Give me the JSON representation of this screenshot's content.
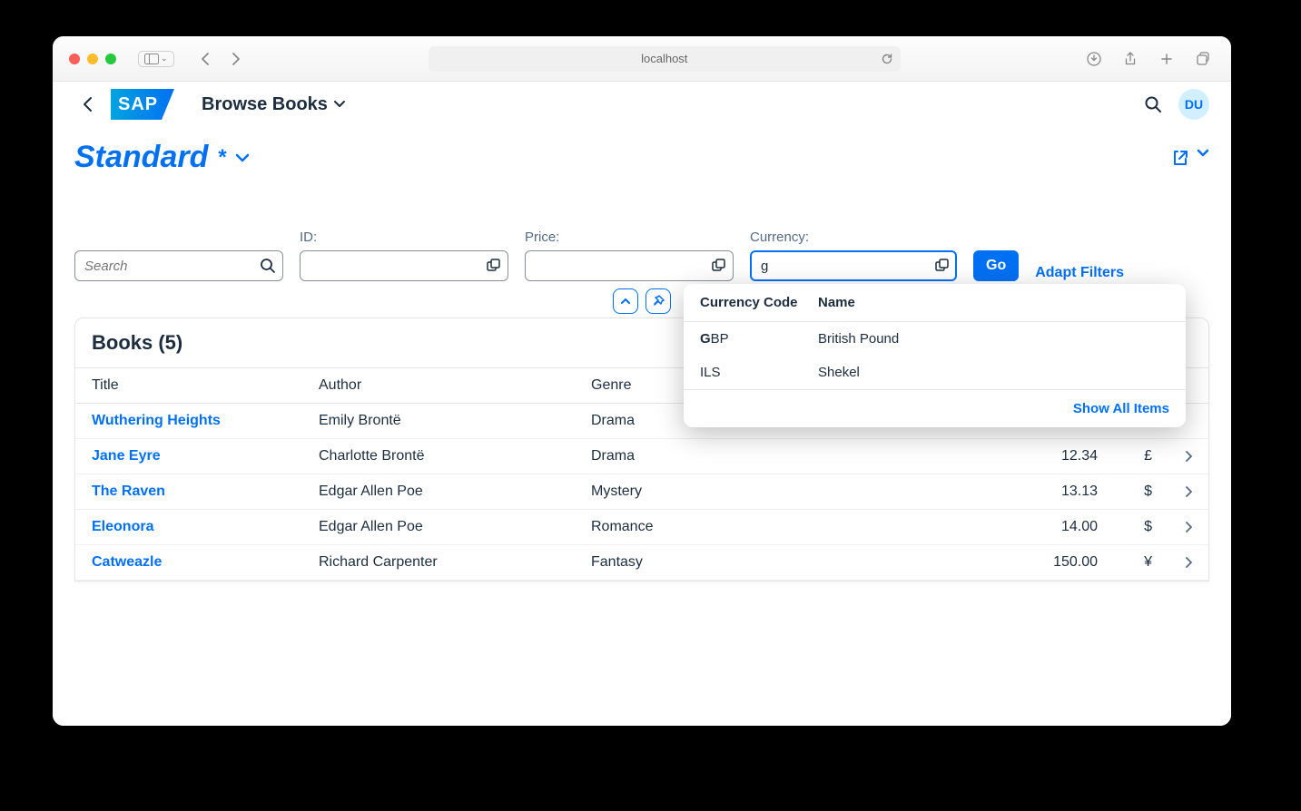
{
  "browser": {
    "address": "localhost"
  },
  "shell": {
    "logo_text": "SAP",
    "title": "Browse Books",
    "avatar_initials": "DU"
  },
  "variant": {
    "title": "Standard",
    "modified_marker": "*"
  },
  "filters": {
    "search_placeholder": "Search",
    "id_label": "ID:",
    "price_label": "Price:",
    "currency_label": "Currency:",
    "currency_value": "g",
    "go_label": "Go",
    "adapt_label": "Adapt Filters"
  },
  "suggestions": {
    "header_code": "Currency Code",
    "header_name": "Name",
    "items": [
      {
        "code_bold": "G",
        "code_rest": "BP",
        "name": "British Pound"
      },
      {
        "code_bold": "",
        "code_rest": "ILS",
        "name": "Shekel"
      }
    ],
    "show_all_label": "Show All Items"
  },
  "table": {
    "heading": "Books (5)",
    "columns": {
      "title": "Title",
      "author": "Author",
      "genre": "Genre",
      "price": "",
      "currency": ""
    },
    "rows": [
      {
        "title": "Wuthering Heights",
        "author": "Emily Brontë",
        "genre": "Drama",
        "price": "",
        "currency": ""
      },
      {
        "title": "Jane Eyre",
        "author": "Charlotte Brontë",
        "genre": "Drama",
        "price": "12.34",
        "currency": "£"
      },
      {
        "title": "The Raven",
        "author": "Edgar Allen Poe",
        "genre": "Mystery",
        "price": "13.13",
        "currency": "$"
      },
      {
        "title": "Eleonora",
        "author": "Edgar Allen Poe",
        "genre": "Romance",
        "price": "14.00",
        "currency": "$"
      },
      {
        "title": "Catweazle",
        "author": "Richard Carpenter",
        "genre": "Fantasy",
        "price": "150.00",
        "currency": "¥"
      }
    ]
  }
}
